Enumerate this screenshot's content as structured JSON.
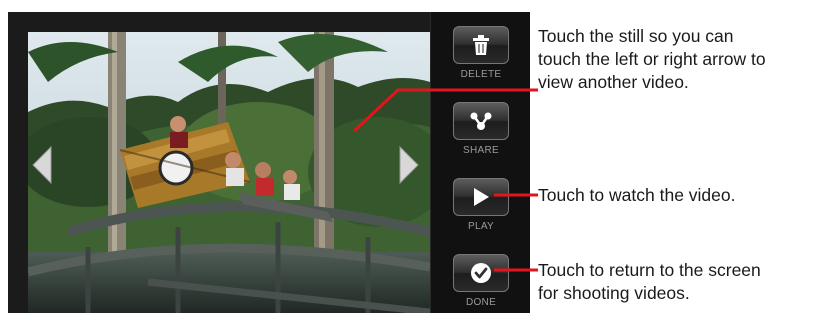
{
  "still": {
    "icon": "video-still-thumbnail",
    "prev_icon": "arrow-left-icon",
    "next_icon": "arrow-right-icon"
  },
  "actions": [
    {
      "label": "DELETE",
      "icon": "trash-icon"
    },
    {
      "label": "SHARE",
      "icon": "share-icon"
    },
    {
      "label": "PLAY",
      "icon": "play-icon"
    },
    {
      "label": "DONE",
      "icon": "checkmark-icon"
    }
  ],
  "callouts": {
    "still_lines": [
      "Touch the still so you can",
      "touch the left or right arrow to",
      "view another video."
    ],
    "play": "Touch to watch the video.",
    "done_lines": [
      "Touch to return to the screen",
      "for shooting videos."
    ]
  },
  "colors": {
    "leader": "#e3151a",
    "action_label": "#9b9b9b",
    "frame": "#1b1b1b"
  }
}
